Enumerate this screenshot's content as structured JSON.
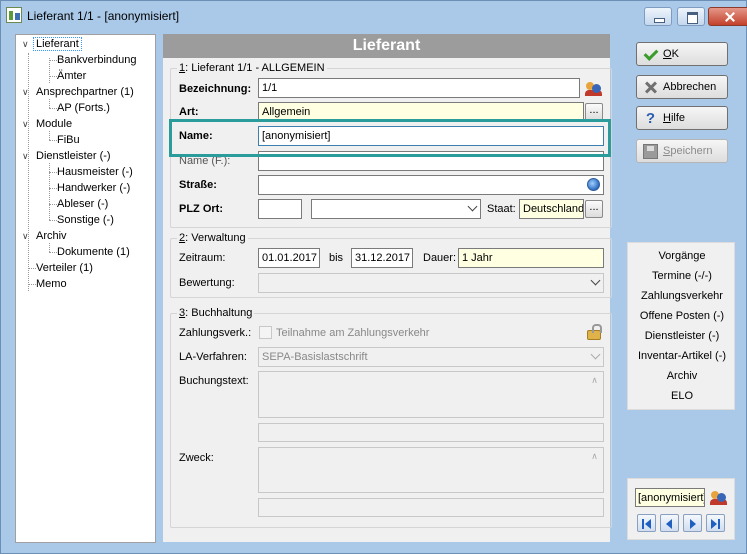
{
  "window": {
    "title": "Lieferant 1/1 - [anonymisiert]"
  },
  "tree": {
    "items": [
      {
        "label": "Lieferant",
        "level": 0,
        "expanded": true,
        "selected": true
      },
      {
        "label": "Bankverbindung",
        "level": 1
      },
      {
        "label": "Ämter",
        "level": 1
      },
      {
        "label": "Ansprechpartner (1)",
        "level": 0,
        "expanded": true
      },
      {
        "label": "AP (Forts.)",
        "level": 1
      },
      {
        "label": "Module",
        "level": 0,
        "expanded": true
      },
      {
        "label": "FiBu",
        "level": 1
      },
      {
        "label": "Dienstleister (-)",
        "level": 0,
        "expanded": true
      },
      {
        "label": "Hausmeister (-)",
        "level": 1
      },
      {
        "label": "Handwerker (-)",
        "level": 1
      },
      {
        "label": "Ableser (-)",
        "level": 1
      },
      {
        "label": "Sonstige (-)",
        "level": 1
      },
      {
        "label": "Archiv",
        "level": 0,
        "expanded": true
      },
      {
        "label": "Dokumente (1)",
        "level": 1
      },
      {
        "label": "Verteiler (1)",
        "level": 0
      },
      {
        "label": "Memo",
        "level": 0
      }
    ]
  },
  "header": {
    "title": "Lieferant"
  },
  "allgemein": {
    "legend_num": "1",
    "legend_text": ": Lieferant 1/1 - ALLGEMEIN",
    "bezeichnung_label": "Bezeichnung:",
    "bezeichnung_value": "1/1",
    "art_label": "Art:",
    "art_value": "Allgemein",
    "name_label": "Name:",
    "name_value": "[anonymisiert]",
    "name_f_label": "Name (F.):",
    "name_f_value": "",
    "strasse_label": "Straße:",
    "strasse_value": "",
    "plz_ort_label": "PLZ Ort:",
    "plz_value": "",
    "ort_value": "",
    "staat_label": "Staat:",
    "staat_value": "Deutschland",
    "dots": "..."
  },
  "verwaltung": {
    "legend_num": "2",
    "legend_text": ": Verwaltung",
    "zeitraum_label": "Zeitraum:",
    "zeitraum_from": "01.01.2017",
    "bis_label": "bis",
    "zeitraum_to": "31.12.2017",
    "dauer_label": "Dauer:",
    "dauer_value": "1 Jahr",
    "bewertung_label": "Bewertung:",
    "bewertung_value": ""
  },
  "buchhaltung": {
    "legend_num": "3",
    "legend_text": ": Buchhaltung",
    "zahlungsverk_label": "Zahlungsverk.:",
    "teilnahme_label": "Teilnahme am Zahlungsverkehr",
    "la_verfahren_label": "LA-Verfahren:",
    "la_verfahren_value": "SEPA-Basislastschrift",
    "buchungstext_label": "Buchungstext:",
    "buchungstext_value": "",
    "zweck_label": "Zweck:",
    "zweck_value": ""
  },
  "buttons": {
    "ok": "OK",
    "ok_key": "O",
    "abbrechen": "Abbrechen",
    "hilfe": "Hilfe",
    "hilfe_key": "H",
    "speichern": "Speichern",
    "speichern_key": "S"
  },
  "right_panel": {
    "items": [
      "Vorgänge",
      "Termine (-/-)",
      "Zahlungsverkehr",
      "Offene Posten (-)",
      "Dienstleister (-)",
      "Inventar-Artikel (-)",
      "Archiv",
      "ELO"
    ]
  },
  "nav": {
    "search_value": "[anonymisiert]"
  },
  "colors": {
    "highlight": "#2a9c9c",
    "yellow_field": "#ffffe1",
    "header_bar": "#9c9c9c"
  }
}
